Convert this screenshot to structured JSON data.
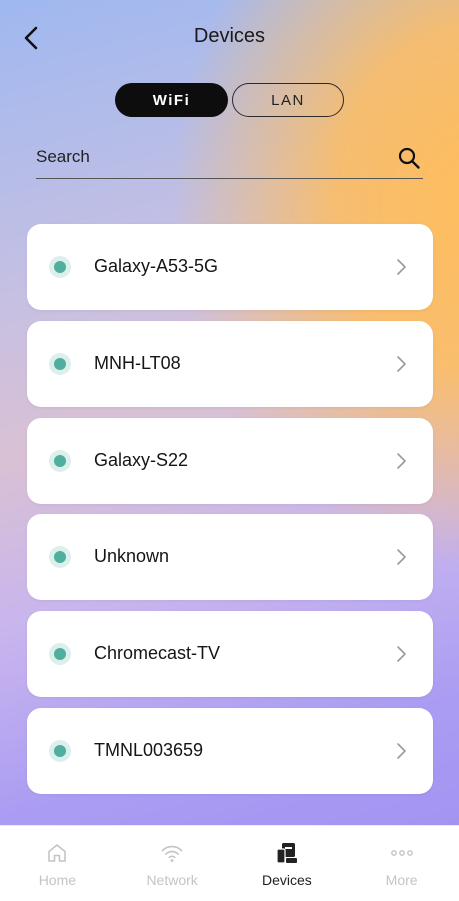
{
  "header": {
    "title": "Devices",
    "back_icon": "chevron-left-icon"
  },
  "toggle": {
    "options": [
      "WiFi",
      "LAN"
    ],
    "selected": "WiFi"
  },
  "search": {
    "placeholder": "Search",
    "value": "",
    "icon": "search-icon"
  },
  "devices": [
    {
      "name": "Galaxy-A53-5G",
      "status": "online"
    },
    {
      "name": "MNH-LT08",
      "status": "online"
    },
    {
      "name": "Galaxy-S22",
      "status": "online"
    },
    {
      "name": "Unknown",
      "status": "online"
    },
    {
      "name": "Chromecast-TV",
      "status": "online"
    },
    {
      "name": "TMNL003659",
      "status": "online"
    }
  ],
  "tabbar": {
    "items": [
      {
        "label": "Home",
        "icon": "home-icon",
        "active": false
      },
      {
        "label": "Network",
        "icon": "wifi-icon",
        "active": false
      },
      {
        "label": "Devices",
        "icon": "devices-icon",
        "active": true
      },
      {
        "label": "More",
        "icon": "more-icon",
        "active": false
      }
    ]
  },
  "colors": {
    "status_online": "#4fae9c",
    "active_tab": "#222222",
    "inactive_tab": "#c4c4c4",
    "toggle_selected_bg": "#0d0d0d"
  }
}
